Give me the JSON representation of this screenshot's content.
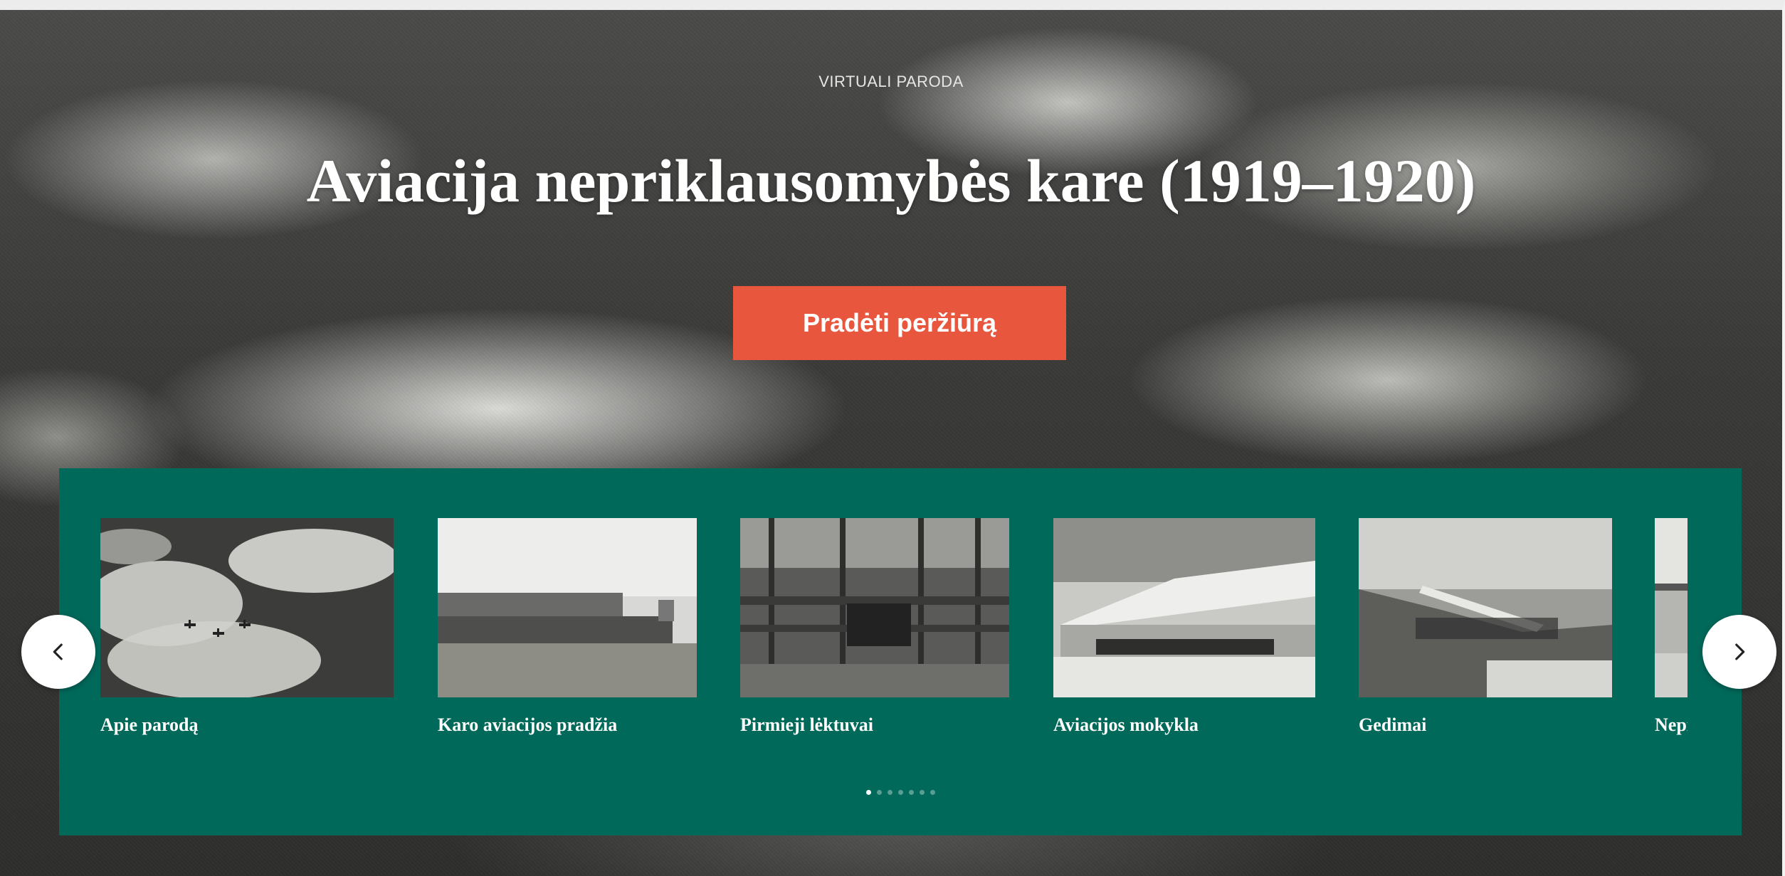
{
  "hero": {
    "eyebrow": "VIRTUALI PARODA",
    "title": "Aviacija nepriklausomybės kare (1919–1920)",
    "start_button": "Pradėti peržiūrą"
  },
  "carousel": {
    "items": [
      {
        "label": "Apie parodą"
      },
      {
        "label": "Karo aviacijos pradžia"
      },
      {
        "label": "Pirmieji lėktuvai"
      },
      {
        "label": "Aviacijos mokykla"
      },
      {
        "label": "Gedimai"
      },
      {
        "label": "Nepriklausomybės karas"
      }
    ],
    "page_count": 7,
    "active_page": 1
  },
  "colors": {
    "panel": "#01695a",
    "accent_button": "#e8573d"
  },
  "icons": {
    "prev": "chevron-left-icon",
    "next": "chevron-right-icon"
  }
}
